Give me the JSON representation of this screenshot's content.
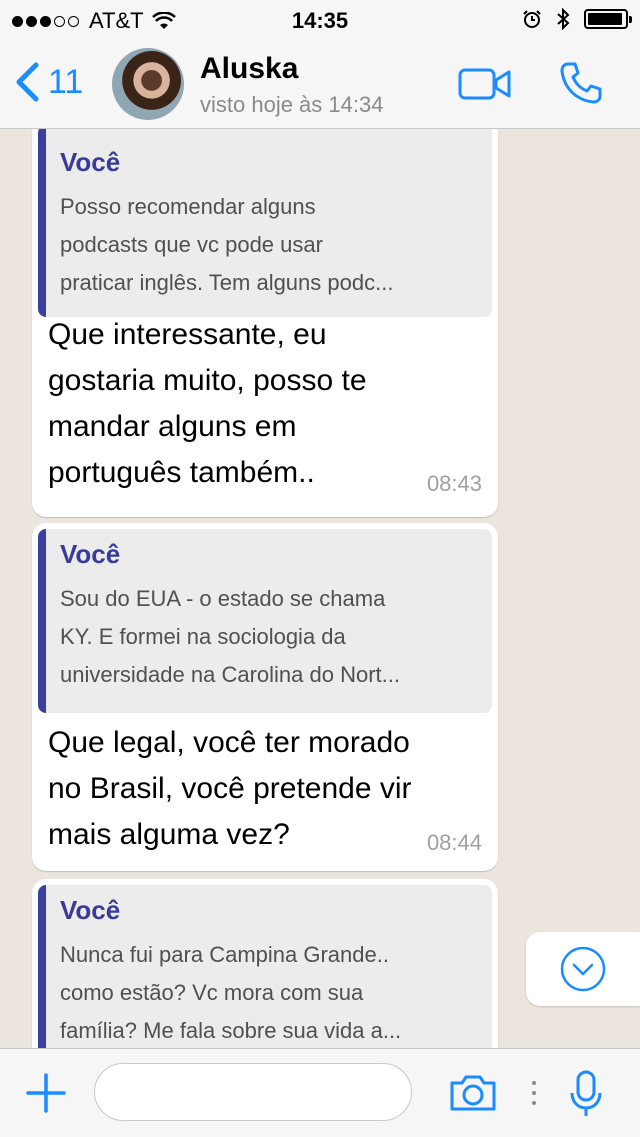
{
  "status_bar": {
    "carrier": "AT&T",
    "time": "14:35"
  },
  "header": {
    "back_count": "11",
    "contact_name": "Aluska",
    "contact_status": "visto hoje às 14:34"
  },
  "messages": [
    {
      "quote_author": "Você",
      "quote_lines": [
        "Posso recomendar alguns",
        "podcasts que vc pode usar",
        "praticar inglês. Tem alguns podc..."
      ],
      "text_lines": [
        "Que interessante, eu",
        "gostaria muito, posso te",
        "mandar alguns em",
        "português também.."
      ],
      "time": "08:43"
    },
    {
      "quote_author": "Você",
      "quote_lines": [
        "Sou do EUA - o estado se chama",
        "KY. E formei na sociologia da",
        "universidade na Carolina do Nort..."
      ],
      "text_lines": [
        "Que legal, você ter morado",
        "no Brasil, você pretende vir",
        "mais alguma vez?"
      ],
      "time": "08:44"
    },
    {
      "quote_author": "Você",
      "quote_lines": [
        "Nunca fui para Campina Grande..",
        "como estão? Vc mora com sua",
        "família? Me fala sobre sua vida a..."
      ]
    }
  ],
  "input": {
    "placeholder": ""
  },
  "colors": {
    "accent": "#1a8cff",
    "quote_bar": "#3b3f9e",
    "chat_bg": "#ece5dd"
  }
}
